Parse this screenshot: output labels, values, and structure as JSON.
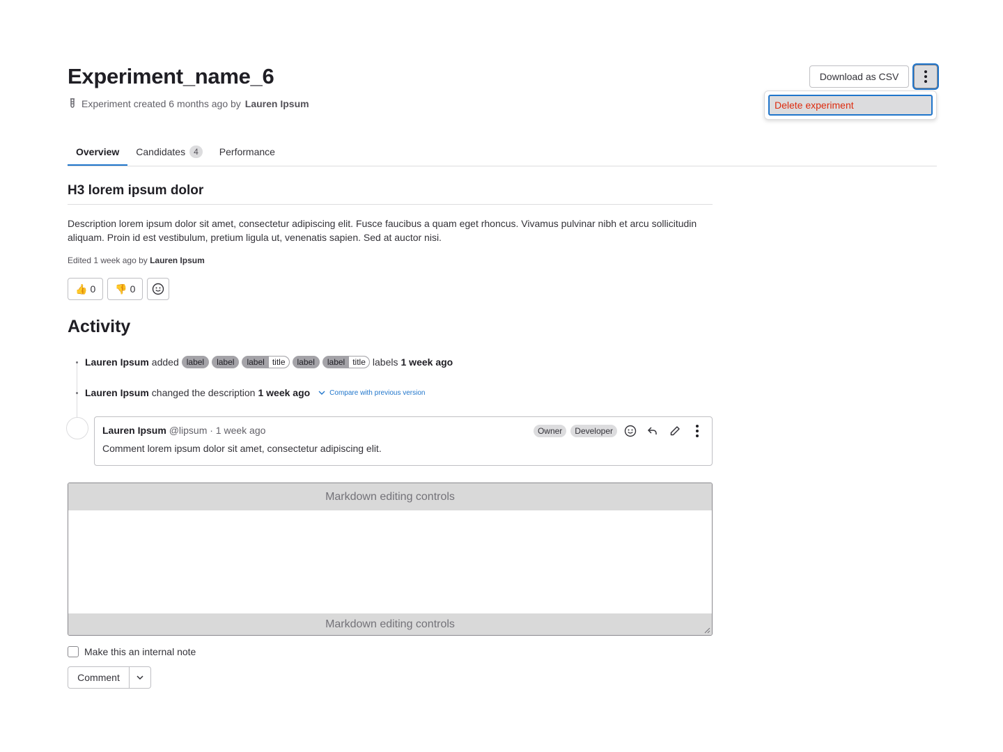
{
  "header": {
    "title": "Experiment_name_6",
    "subtitle_prefix": "Experiment created 6 months ago by",
    "subtitle_author": "Lauren Ipsum",
    "flask_icon": "flask-icon",
    "download_label": "Download as CSV",
    "more_icon": "ellipsis-v-icon"
  },
  "dropdown": {
    "items": [
      {
        "label": "Delete experiment",
        "color": "#dd2b0e"
      }
    ]
  },
  "tabs": [
    {
      "label": "Overview",
      "active": true
    },
    {
      "label": "Candidates",
      "count": "4"
    },
    {
      "label": "Performance"
    }
  ],
  "description": {
    "heading": "H3 lorem ipsum dolor",
    "text": "Description lorem ipsum dolor sit amet, consectetur adipiscing elit. Fusce faucibus a quam eget rhoncus. Vivamus pulvinar nibh et arcu sollicitudin aliquam. Proin id est vestibulum, pretium ligula ut, venenatis sapien. Sed at auctor nisi.",
    "edited_prefix": "Edited 1 week ago by",
    "edited_author": "Lauren Ipsum"
  },
  "reactions": {
    "thumbsup": {
      "emoji": "👍",
      "count": "0"
    },
    "thumbsdown": {
      "emoji": "👎",
      "count": "0"
    },
    "add_icon": "smiley-icon"
  },
  "activity": {
    "title": "Activity",
    "event1": {
      "author": "Lauren Ipsum",
      "verb": "added",
      "labels": [
        {
          "key": "label"
        },
        {
          "key": "label"
        },
        {
          "key": "label",
          "value": "title"
        },
        {
          "key": "label"
        },
        {
          "key": "label",
          "value": "title"
        }
      ],
      "suffix": "labels",
      "time": "1 week ago"
    },
    "event2": {
      "author": "Lauren Ipsum",
      "verb": "changed the description",
      "time": "1 week ago",
      "compare_label": "Compare with previous version"
    }
  },
  "comment": {
    "author": "Lauren Ipsum",
    "handle": "@lipsum",
    "time": "· 1 week ago",
    "roles": [
      "Owner",
      "Developer"
    ],
    "body": "Comment lorem ipsum dolor sit amet, consectetur adipiscing elit."
  },
  "editor": {
    "top_bar": "Markdown editing controls",
    "bottom_bar": "Markdown editing controls",
    "value": ""
  },
  "internal_note_label": "Make this an internal note",
  "comment_button_label": "Comment",
  "colors": {
    "accent": "#1f75cb",
    "danger": "#dd2b0e",
    "label_bg": "#a4a3a8"
  }
}
